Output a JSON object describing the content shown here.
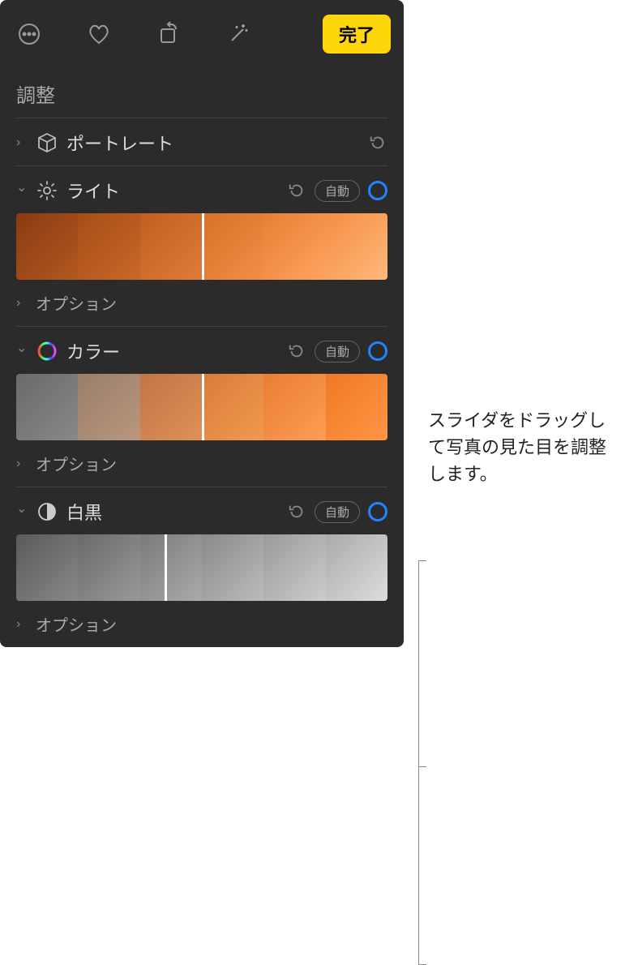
{
  "toolbar": {
    "done_label": "完了"
  },
  "header": {
    "title": "調整"
  },
  "sections": {
    "portrait": {
      "label": "ポートレート"
    },
    "light": {
      "label": "ライト",
      "auto": "自動",
      "options": "オプション"
    },
    "color": {
      "label": "カラー",
      "auto": "自動",
      "options": "オプション"
    },
    "bw": {
      "label": "白黒",
      "auto": "自動",
      "options": "オプション"
    }
  },
  "callout": {
    "text": "スライダをドラッグして写真の見た目を調整します。"
  }
}
